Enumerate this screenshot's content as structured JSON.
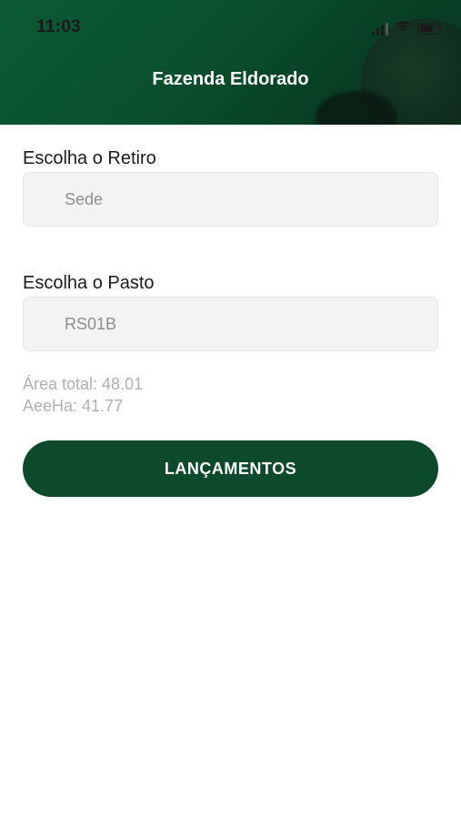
{
  "status_bar": {
    "time": "11:03",
    "icons": [
      "signal-icon",
      "wifi-icon",
      "battery-icon"
    ]
  },
  "header": {
    "title": "Fazenda Eldorado"
  },
  "form": {
    "retiro": {
      "label": "Escolha o Retiro",
      "value": "Sede"
    },
    "pasto": {
      "label": "Escolha o Pasto",
      "value": "RS01B"
    }
  },
  "info": {
    "area_total": "Área total: 48.01",
    "aeeha": "AeeHa: 41.77"
  },
  "actions": {
    "lancamentos_label": "LANÇAMENTOS"
  },
  "colors": {
    "header_green": "#0a4f2e",
    "button_green": "#0d4a2c",
    "field_bg": "#f3f3f3"
  }
}
